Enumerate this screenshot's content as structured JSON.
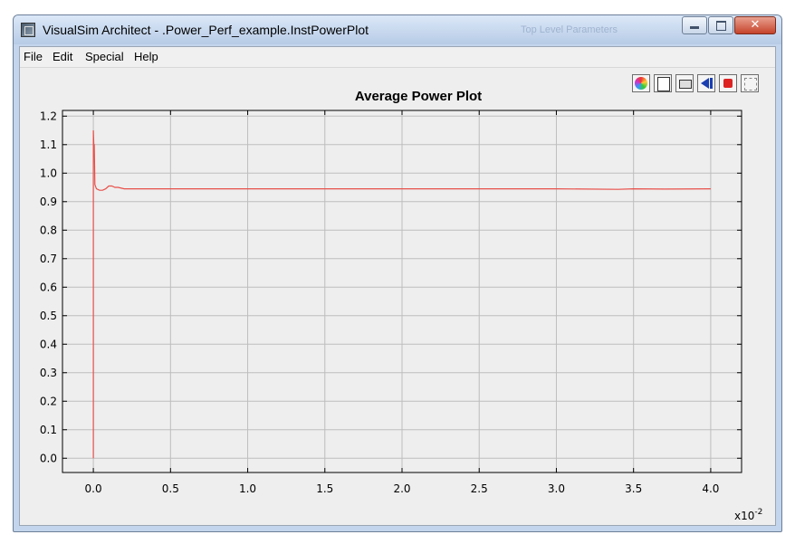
{
  "window": {
    "title": "VisualSim Architect - .Power_Perf_example.InstPowerPlot",
    "background_title": "Top Level Parameters"
  },
  "menu": {
    "items": [
      "File",
      "Edit",
      "Special",
      "Help"
    ]
  },
  "toolbar": {
    "buttons": [
      "color-palette-icon",
      "save-icon",
      "print-icon",
      "reset-axes-icon",
      "fill-icon",
      "zoom-fit-icon"
    ]
  },
  "chart_data": {
    "type": "line",
    "title": "Average Power Plot",
    "xlabel": "",
    "ylabel": "",
    "x_multiplier_label": "x10",
    "x_multiplier_exponent": "-2",
    "xlim": [
      -0.2,
      4.2
    ],
    "ylim": [
      -0.05,
      1.22
    ],
    "x_ticks": [
      "0.0",
      "0.5",
      "1.0",
      "1.5",
      "2.0",
      "2.5",
      "3.0",
      "3.5",
      "4.0"
    ],
    "x_tick_values": [
      0.0,
      0.5,
      1.0,
      1.5,
      2.0,
      2.5,
      3.0,
      3.5,
      4.0
    ],
    "y_ticks": [
      "0.0",
      "0.1",
      "0.2",
      "0.3",
      "0.4",
      "0.5",
      "0.6",
      "0.7",
      "0.8",
      "0.9",
      "1.0",
      "1.1",
      "1.2"
    ],
    "y_tick_values": [
      0.0,
      0.1,
      0.2,
      0.3,
      0.4,
      0.5,
      0.6,
      0.7,
      0.8,
      0.9,
      1.0,
      1.1,
      1.2
    ],
    "grid": true,
    "series": [
      {
        "color": "#e8504a",
        "x": [
          0.0,
          0.0,
          0.003,
          0.006,
          0.01,
          0.02,
          0.04,
          0.06,
          0.08,
          0.1,
          0.12,
          0.14,
          0.16,
          0.2,
          0.25,
          0.5,
          1.0,
          1.5,
          2.0,
          2.5,
          3.0,
          3.4,
          3.5,
          3.7,
          4.0
        ],
        "y": [
          0.0,
          1.15,
          1.1,
          1.1,
          0.96,
          0.945,
          0.94,
          0.94,
          0.945,
          0.955,
          0.955,
          0.95,
          0.95,
          0.945,
          0.945,
          0.945,
          0.945,
          0.945,
          0.945,
          0.945,
          0.945,
          0.943,
          0.945,
          0.944,
          0.945
        ]
      }
    ]
  }
}
